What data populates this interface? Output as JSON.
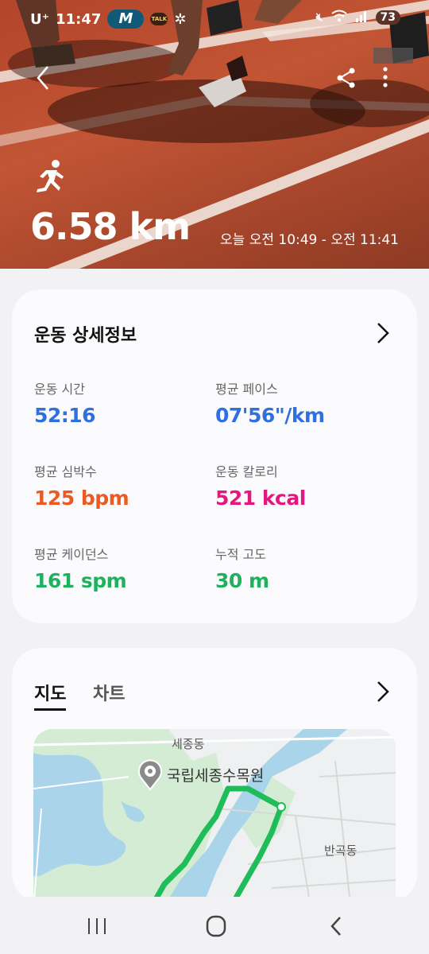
{
  "status_bar": {
    "carrier": "U⁺",
    "time": "11:47",
    "badge": "M",
    "talk": "TALK",
    "battery": "73"
  },
  "hero": {
    "distance": "6.58 km",
    "time_range": "오늘 오전 10:49 - 오전 11:41"
  },
  "details": {
    "title": "운동 상세정보",
    "stats": [
      {
        "label": "운동 시간",
        "value": "52:16",
        "color": "#2f6fe0"
      },
      {
        "label": "평균 페이스",
        "value": "07'56\"/km",
        "color": "#2f6fe0"
      },
      {
        "label": "평균 심박수",
        "value": "125 bpm",
        "color": "#ec5a24"
      },
      {
        "label": "운동 칼로리",
        "value": "521 kcal",
        "color": "#e5177f"
      },
      {
        "label": "평균 케이던스",
        "value": "161 spm",
        "color": "#1eb25f"
      },
      {
        "label": "누적 고도",
        "value": "30 m",
        "color": "#1eb25f"
      }
    ]
  },
  "map_card": {
    "tabs": [
      "지도",
      "차트"
    ],
    "labels": {
      "area_top": "세종동",
      "poi": "국립세종수목원",
      "area_right": "반곡동"
    },
    "route_color": "#1ebd5a"
  }
}
